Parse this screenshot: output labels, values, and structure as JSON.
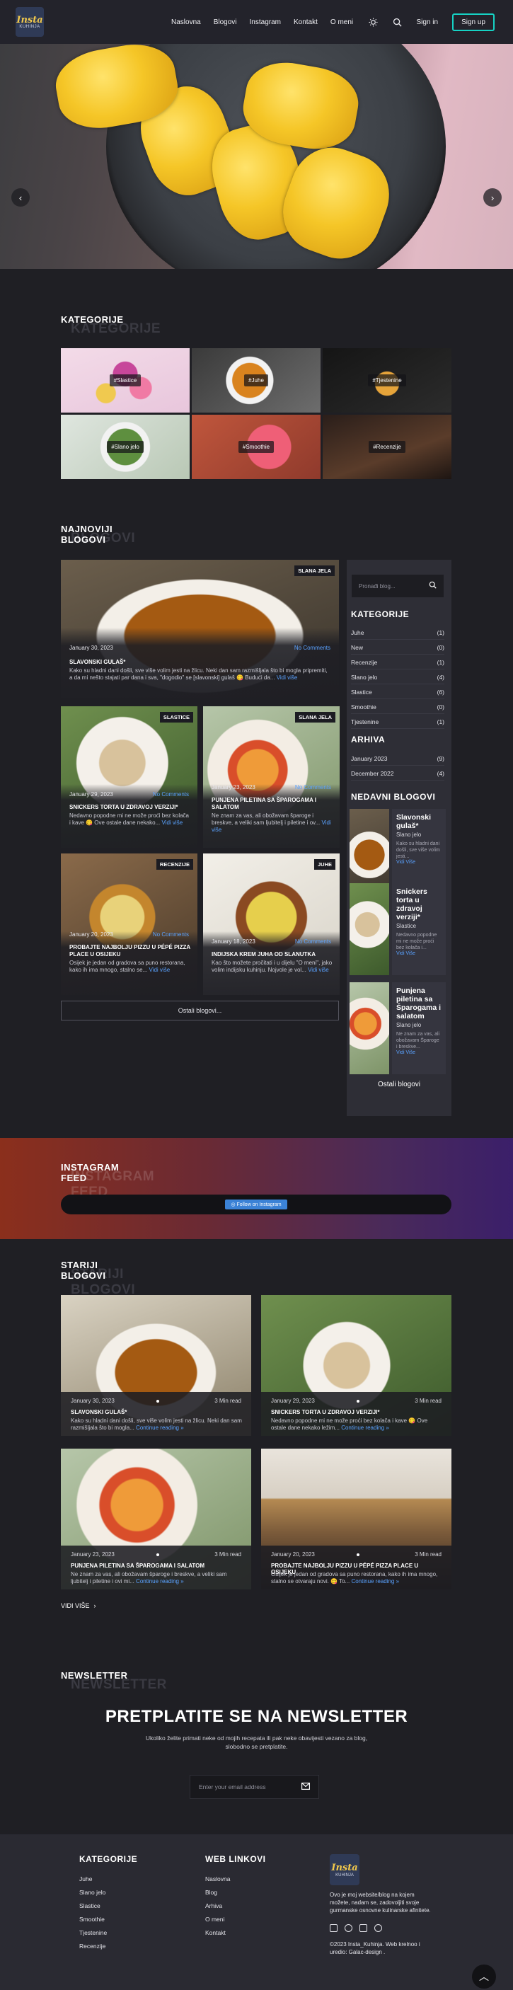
{
  "header": {
    "logo_line1": "Insta",
    "logo_line2": "KUHINJA",
    "nav": [
      "Naslovna",
      "Blogovi",
      "Instagram",
      "Kontakt",
      "O meni"
    ],
    "theme_icon": "sun-icon",
    "search_icon": "search-icon",
    "signin": "Sign in",
    "signup": "Sign up",
    "accent": "#16d2c4"
  },
  "hero": {
    "prev": "‹",
    "next": "›"
  },
  "categories_section": {
    "title": "KATEGORIJE",
    "ghost": "KATEGORIJE",
    "tiles": [
      "#Slastice",
      "#Juhe",
      "#Tjestenine",
      "#Slano jelo",
      "#Smoothie",
      "#Recenzije"
    ]
  },
  "latest_section": {
    "title": "NAJNOVIJI BLOGOVI",
    "ghost": "BLOGOVI",
    "featured": {
      "badge": "SLANA JELA",
      "date": "January 30, 2023",
      "comments": "No Comments",
      "title": "SLAVONSKI GULAŠ*",
      "excerpt": "Kako su hladni dani došli, sve više volim jesti na žlicu. Neki dan sam razmišljala što bi mogla pripremiti, a da mi nešto stajati par dana i sva, \"dogodio\" se [slavonski] gulaš 😋 Budući da...",
      "more": "Vidi više"
    },
    "cards": [
      {
        "badge": "SLASTICE",
        "date": "January 29, 2023",
        "comments": "No Comments",
        "title": "SNICKERS TORTA U ZDRAVOJ VERZIJI*",
        "excerpt": "Nedavno popodne mi ne može proći bez kolača i kave 😋 Ove ostale dane nekako...",
        "more": "Vidi više"
      },
      {
        "badge": "SLANA JELA",
        "date": "January 23, 2023",
        "comments": "No Comments",
        "title": "PUNJENA PILETINA SA ŠPAROGAMA I SALATOM",
        "excerpt": "Ne znam za vas, ali obožavam šparoge i breskve, a veliki sam ljubitelj i piletine i ov...",
        "more": "Vidi više"
      },
      {
        "badge": "RECENZIJE",
        "date": "January 20, 2023",
        "comments": "No Comments",
        "title": "PROBAJTE NAJBOLJU PIZZU U PÉPÉ PIZZA PLACE U OSIJEKU",
        "excerpt": "Osijek je jedan od gradova sa puno restorana, kako ih ima mnogo, stalno se...",
        "more": "Vidi više"
      },
      {
        "badge": "JUHE",
        "date": "January 18, 2023",
        "comments": "No Comments",
        "title": "INDIJSKA KREM JUHA OD SLANUTKA",
        "excerpt": "Kao što možete pročitati i u dijelu \"O meni\", jako volim indijsku kuhinju. Nojvole je vol...",
        "more": "Vidi više"
      }
    ],
    "older_button": "Ostali blogovi..."
  },
  "sidebar": {
    "search_placeholder": "Pronađi blog...",
    "categories_title": "KATEGORIJE",
    "categories": [
      {
        "name": "Juhe",
        "count": "(1)"
      },
      {
        "name": "New",
        "count": "(0)"
      },
      {
        "name": "Recenzije",
        "count": "(1)"
      },
      {
        "name": "Slano jelo",
        "count": "(4)"
      },
      {
        "name": "Slastice",
        "count": "(6)"
      },
      {
        "name": "Smoothie",
        "count": "(0)"
      },
      {
        "name": "Tjestenine",
        "count": "(1)"
      }
    ],
    "archive_title": "ARHIVA",
    "archive": [
      {
        "name": "January 2023",
        "count": "(9)"
      },
      {
        "name": "December 2022",
        "count": "(4)"
      }
    ],
    "recent_title": "NEDAVNI BLOGOVI",
    "recent": [
      {
        "title": "Slavonski gulaš*",
        "cat": "Slano jelo",
        "excerpt": "Kako su hladni dani došli, sve više volim jesti...",
        "more": "Vidi Više"
      },
      {
        "title": "Snickers torta u zdravoj verziji*",
        "cat": "Slastice",
        "excerpt": "Nedavno popodne mi ne može proći bez kolača i...",
        "more": "Vidi Više"
      },
      {
        "title": "Punjena piletina sa Šparogama i salatom",
        "cat": "Slano jelo",
        "excerpt": "Ne znam za vas, ali obožavam Šparoge i breskve...",
        "more": "Vidi Više"
      }
    ],
    "more": "Ostali blogovi"
  },
  "instagram": {
    "title": "INSTAGRAM FEED",
    "ghost": "INSTAGRAM FEED",
    "follow": "Follow on Instagram"
  },
  "older_section": {
    "title": "STARIJI BLOGOVI",
    "ghost": "STARIJI BLOGOVI",
    "posts": [
      {
        "date": "January 30, 2023",
        "read": "3 Min read",
        "title": "SLAVONSKI GULAŠ*",
        "excerpt": "Kako su hladni dani došli, sve više volim jesti na žlicu. Neki dan sam razmišljala što bi mogla...",
        "more": "Continue reading »"
      },
      {
        "date": "January 29, 2023",
        "read": "3 Min read",
        "title": "SNICKERS TORTA U ZDRAVOJ VERZIJI*",
        "excerpt": "Nedavno popodne mi ne može proći bez kolača i kave 😋 Ove ostale dane nekako ležim...",
        "more": "Continue reading »"
      },
      {
        "date": "January 23, 2023",
        "read": "3 Min read",
        "title": "PUNJENA PILETINA SA ŠPAROGAMA I SALATOM",
        "excerpt": "Ne znam za vas, ali obožavam šparoge i breskve, a veliki sam ljubitelj i piletine i ovi mi...",
        "more": "Continue reading »"
      },
      {
        "date": "January 20, 2023",
        "read": "3 Min read",
        "title": "PROBAJTE NAJBOLJU PIZZU U PÉPÉ PIZZA PLACE U OSIJEKU",
        "excerpt": "Osijek je jedan od gradova sa puno restorana, kako ih ima mnogo, stalno se otvaraju novi. 😋 To...",
        "more": "Continue reading »"
      }
    ],
    "see_more": "VIDI VIŠE"
  },
  "newsletter": {
    "label": "NEWSLETTER",
    "ghost": "NEWSLETTER",
    "title": "PRETPLATITE SE NA NEWSLETTER",
    "text": "Ukoliko želite primati neke od mojih recepata ili pak neke obavijesti vezano za blog, slobodno se pretplatite.",
    "placeholder": "Enter your email address"
  },
  "footer": {
    "cat_title": "KATEGORIJE",
    "cat_links": [
      "Juhe",
      "Slano jelo",
      "Slastice",
      "Smoothie",
      "Tjestenine",
      "Recenzije"
    ],
    "web_title": "WEB LINKOVI",
    "web_links": [
      "Naslovna",
      "Blog",
      "Arhiva",
      "O meni",
      "Kontakt"
    ],
    "about": "Ovo je moj website/blog na kojem možete, nadam se, zadovoljiti svoje gurmanske osnovne kulinarske afinitete.",
    "copyright": "©2023 Insta_Kuhinja. Web krelnoo i uredio: Galac-design ."
  }
}
